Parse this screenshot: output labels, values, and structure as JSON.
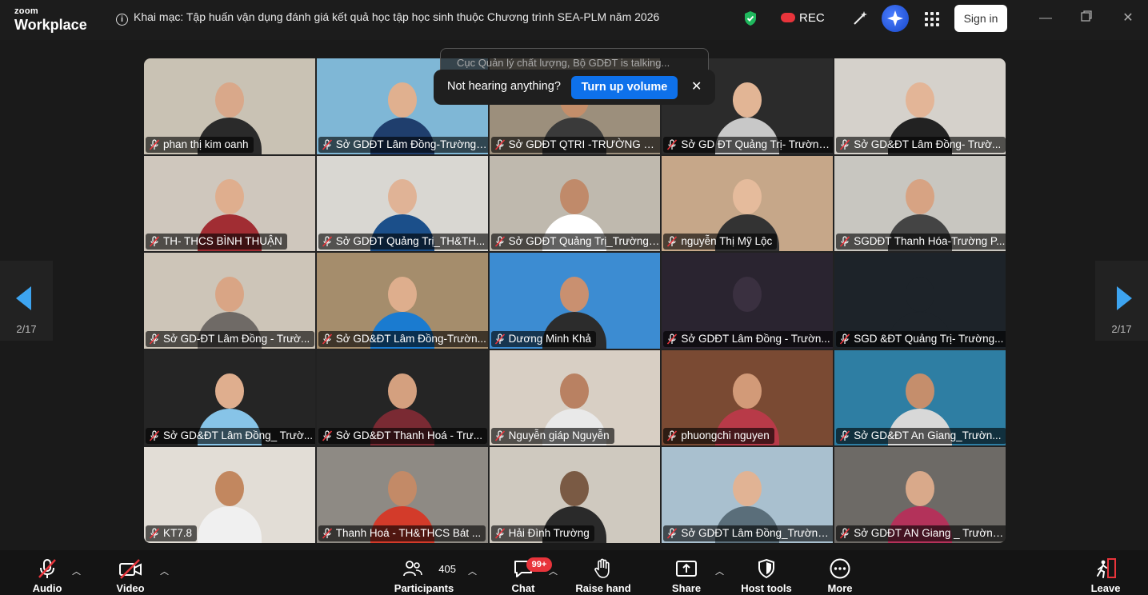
{
  "app": {
    "brand_top": "zoom",
    "brand_bottom": "Workplace"
  },
  "meeting": {
    "title": "Khai mạc: Tập huấn vận dụng đánh giá kết quả học tập học sinh thuộc Chương trình SEA-PLM năm 2026"
  },
  "topbar": {
    "rec_label": "REC",
    "signin_label": "Sign in"
  },
  "toast": {
    "behind_text": "Cục Quản lý chất lượng, Bộ GDĐT is talking...",
    "message": "Not hearing anything?",
    "button": "Turn up volume",
    "close": "✕"
  },
  "pager": {
    "left_label": "2/17",
    "right_label": "2/17"
  },
  "participants": [
    {
      "name": "phan thị kim oanh",
      "bg": "#c9c2b4",
      "skin": "#d9a88a",
      "shirt": "#2a2a2a"
    },
    {
      "name": "Sở GDĐT Lâm Đồng-Trường ...",
      "bg": "#7fb7d6",
      "skin": "#e0b08f",
      "shirt": "#1f3e6d"
    },
    {
      "name": "Sở GDĐT QTRI -TRƯỜNG TH...",
      "bg": "#9c8f7c",
      "skin": "#c48e6a",
      "shirt": "#3a3a3a"
    },
    {
      "name": "Sở GD ĐT Quảng Trị- Trường...",
      "bg": "#2b2b2b",
      "skin": "#e2b595",
      "shirt": "#c8c8c8"
    },
    {
      "name": "Sở GD&ĐT Lâm Đồng- Trườ...",
      "bg": "#d5d1cb",
      "skin": "#e3b597",
      "shirt": "#222222"
    },
    {
      "name": "TH- THCS BÌNH THUẬN",
      "bg": "#cfc7bd",
      "skin": "#dfae8e",
      "shirt": "#a12d33"
    },
    {
      "name": "Sở GDĐT Quảng Trị_TH&TH...",
      "bg": "#d9d7d2",
      "skin": "#e0b396",
      "shirt": "#1b4f8a"
    },
    {
      "name": "Sở GDĐT Quảng Trị_Trường ...",
      "bg": "#bfb9ae",
      "skin": "#c08a6a",
      "shirt": "#ffffff"
    },
    {
      "name": "nguyễn Thị Mỹ Lộc",
      "bg": "#c6a789",
      "skin": "#e5bb9c",
      "shirt": "#333333"
    },
    {
      "name": "SGDĐT Thanh Hóa-Trường P...",
      "bg": "#c8c6c0",
      "skin": "#d7a383",
      "shirt": "#444444"
    },
    {
      "name": "Sở GD-ĐT Lâm Đồng - Trườ...",
      "bg": "#cdc5b8",
      "skin": "#d9a585",
      "shirt": "#6f6a66"
    },
    {
      "name": "Sở GD&ĐT Lâm Đồng-Trườn...",
      "bg": "#a58d6c",
      "skin": "#deae8d",
      "shirt": "#1a7bd0"
    },
    {
      "name": "Dương Minh Khả",
      "bg": "#3c8cd2",
      "skin": "#c99070",
      "shirt": "#2c2c2c"
    },
    {
      "name": "Sở GDĐT Lâm Đồng - Trườn...",
      "bg": "#2a2430",
      "skin": "#3a3040",
      "shirt": "#2a2430"
    },
    {
      "name": "SGD &ĐT Quảng Trị- Trường...",
      "bg": "#1d2329",
      "skin": "#1d2329",
      "shirt": "#1d2329"
    },
    {
      "name": "Sở GD&ĐT Lâm Đồng_ Trườ...",
      "bg": "#252525",
      "skin": "#dfae8e",
      "shirt": "#87c4e8"
    },
    {
      "name": "Sở GD&ĐT Thanh Hoá - Trư...",
      "bg": "#252525",
      "skin": "#d4a07f",
      "shirt": "#7a2a33"
    },
    {
      "name": "Nguyễn giáp Nguyễn",
      "bg": "#d8cfc4",
      "skin": "#b98162",
      "shirt": "#e9e9e9"
    },
    {
      "name": "phuongchi nguyen",
      "bg": "#7a4a33",
      "skin": "#d29a78",
      "shirt": "#b83a48"
    },
    {
      "name": "Sở GD&ĐT An Giang_Trườn...",
      "bg": "#2e7ea3",
      "skin": "#c58e6c",
      "shirt": "#d8d8d8"
    },
    {
      "name": "KT7.8",
      "bg": "#e2ddd6",
      "skin": "#c2875f",
      "shirt": "#f0f0f0"
    },
    {
      "name": "Thanh Hoá - TH&THCS Bát ...",
      "bg": "#8e8a84",
      "skin": "#c38a67",
      "shirt": "#d33b2a"
    },
    {
      "name": "Hải Đình Trường",
      "bg": "#cfc9bf",
      "skin": "#7a5a44",
      "shirt": "#2a2a2a"
    },
    {
      "name": "Sở GDĐT Lâm Đồng_Trường ...",
      "bg": "#a9c0cf",
      "skin": "#e1b394",
      "shirt": "#5a6e7a"
    },
    {
      "name": "Sở GDĐT AN Giang _ Trường...",
      "bg": "#6d6a66",
      "skin": "#d9a98a",
      "shirt": "#b3325a"
    }
  ],
  "toolbar": {
    "audio": "Audio",
    "video": "Video",
    "participants": "Participants",
    "participants_count": "405",
    "chat": "Chat",
    "chat_badge": "99+",
    "raise_hand": "Raise hand",
    "share": "Share",
    "host_tools": "Host tools",
    "more": "More",
    "leave": "Leave"
  },
  "colors": {
    "accent": "#0e71eb",
    "danger": "#e8343b",
    "shield": "#1fb85d"
  }
}
